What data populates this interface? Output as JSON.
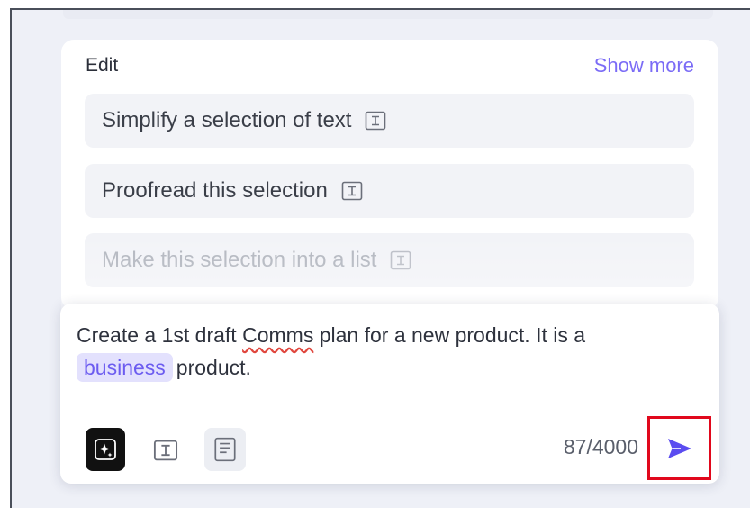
{
  "edit_panel": {
    "title": "Edit",
    "show_more_label": "Show more",
    "prompts": [
      {
        "label": "Simplify a selection of text",
        "icon": "text-selection-icon"
      },
      {
        "label": "Proofread this selection",
        "icon": "text-selection-icon"
      },
      {
        "label": "Make this selection into a list",
        "icon": "text-selection-icon"
      }
    ]
  },
  "composer": {
    "text_part1": "Create a 1st draft ",
    "misspelled_word": "Comms",
    "text_part2": " plan for a new product. It is a",
    "chip_label": "business",
    "text_part3": "product.",
    "char_count": "87/4000",
    "tools": [
      "ai-sparkle-icon",
      "text-selection-icon",
      "document-icon"
    ],
    "send_icon": "send-arrow-icon"
  },
  "colors": {
    "accent": "#7b6cf6",
    "chip_bg": "#e3e1fd",
    "highlight_box": "#e1081c",
    "send_arrow": "#5b4cf0"
  }
}
